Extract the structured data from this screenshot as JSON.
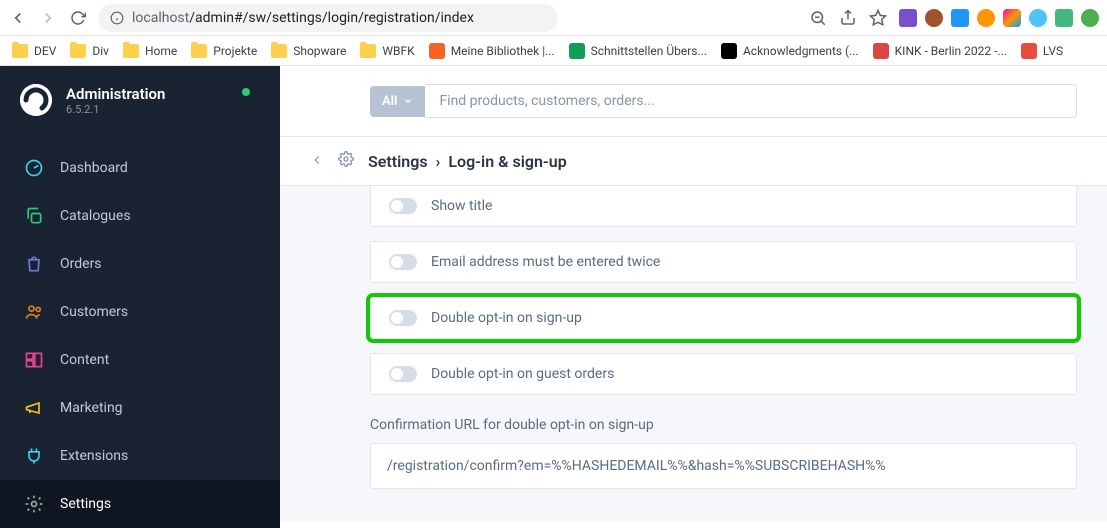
{
  "browser": {
    "url_host": "localhost",
    "url_path": "/admin#/sw/settings/login/registration/index"
  },
  "bookmarks": [
    {
      "label": "DEV",
      "type": "folder"
    },
    {
      "label": "Div",
      "type": "folder"
    },
    {
      "label": "Home",
      "type": "folder"
    },
    {
      "label": "Projekte",
      "type": "folder"
    },
    {
      "label": "Shopware",
      "type": "folder"
    },
    {
      "label": "WBFK",
      "type": "folder"
    },
    {
      "label": "Meine Bibliothek |...",
      "type": "link",
      "color": "#f26522"
    },
    {
      "label": "Schnittstellen Übers...",
      "type": "link",
      "color": "#0f9d58"
    },
    {
      "label": "Acknowledgments (...",
      "type": "link",
      "color": "#000"
    },
    {
      "label": "KINK - Berlin 2022 -...",
      "type": "link",
      "color": "#d44"
    },
    {
      "label": "LVS",
      "type": "link",
      "color": "#e74c3c"
    }
  ],
  "brand": {
    "title": "Administration",
    "version": "6.5.2.1"
  },
  "nav": [
    {
      "label": "Dashboard",
      "icon": "gauge-icon",
      "color": "#3ecff0"
    },
    {
      "label": "Catalogues",
      "icon": "copy-icon",
      "color": "#2ecc71"
    },
    {
      "label": "Orders",
      "icon": "bag-icon",
      "color": "#6c7ae0"
    },
    {
      "label": "Customers",
      "icon": "users-icon",
      "color": "#e67e22"
    },
    {
      "label": "Content",
      "icon": "layout-icon",
      "color": "#e84393"
    },
    {
      "label": "Marketing",
      "icon": "megaphone-icon",
      "color": "#f1c40f"
    },
    {
      "label": "Extensions",
      "icon": "plug-icon",
      "color": "#3ecff0"
    },
    {
      "label": "Settings",
      "icon": "gear-icon",
      "color": "#95a5a6",
      "active": true
    }
  ],
  "search": {
    "filter": "All",
    "placeholder": "Find products, customers, orders..."
  },
  "breadcrumb": {
    "parent": "Settings",
    "current": "Log-in & sign-up"
  },
  "settings": {
    "show_title": "Show title",
    "email_twice": "Email address must be entered twice",
    "double_optin_signup": "Double opt-in on sign-up",
    "double_optin_guest": "Double opt-in on guest orders",
    "confirm_url_label": "Confirmation URL for double opt-in on sign-up",
    "confirm_url_value": "/registration/confirm?em=%%HASHEDEMAIL%%&hash=%%SUBSCRIBEHASH%%"
  }
}
